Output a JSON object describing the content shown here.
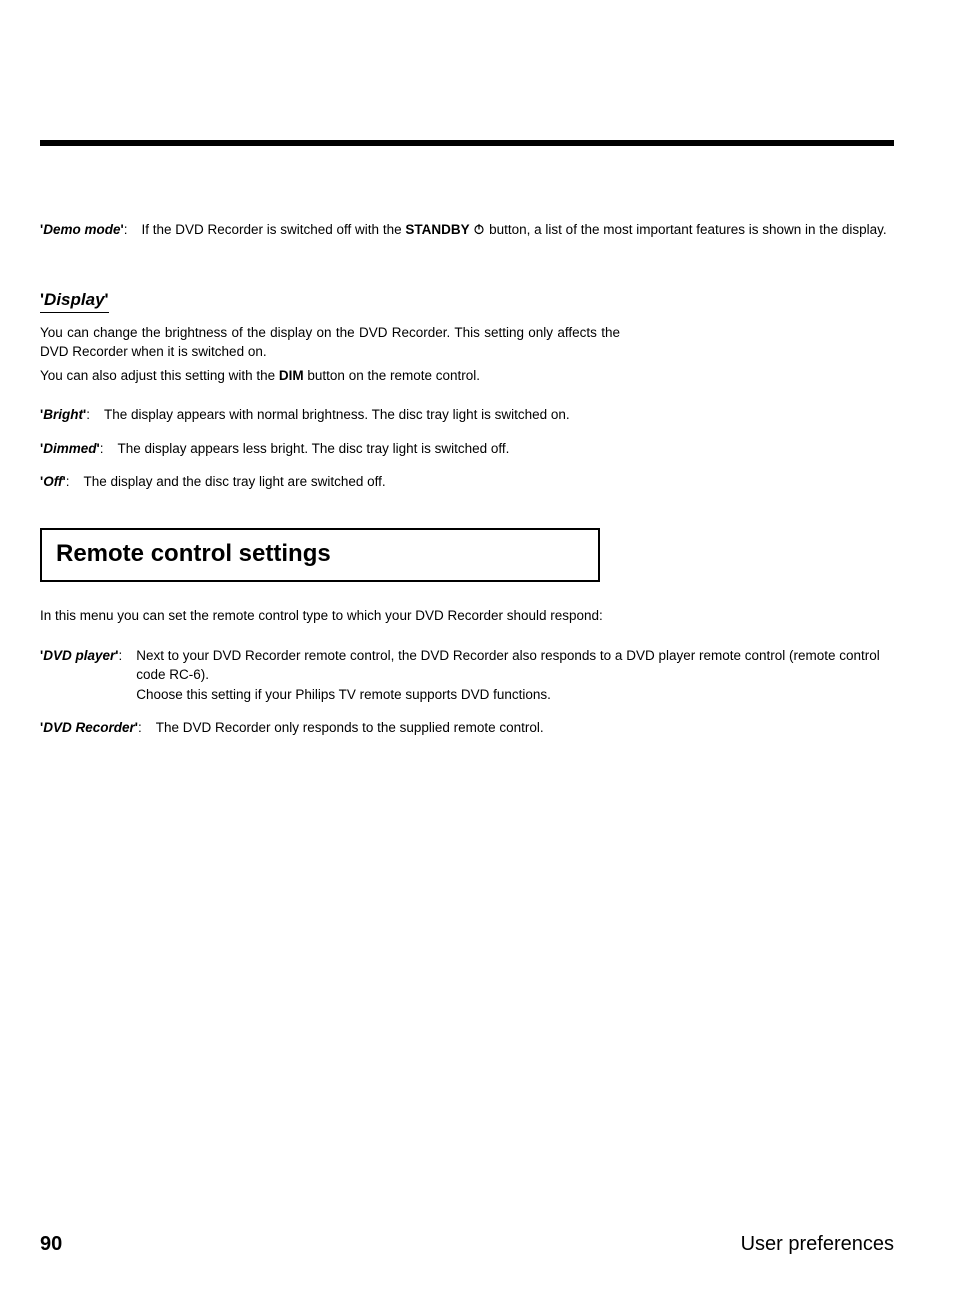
{
  "demo_mode": {
    "label": "Demo mode",
    "text_before": "If the DVD Recorder is switched off with the ",
    "button_label": "STANDBY",
    "text_after": " button, a list of the most important features is shown in the display."
  },
  "display_section": {
    "title": "Display",
    "para1": "You can change the brightness of the display on the DVD Recorder. This setting only affects the DVD Recorder when it is switched on.",
    "para2_before": "You can also adjust this setting with the ",
    "para2_bold": "DIM",
    "para2_after": " button on the remote control.",
    "items": [
      {
        "label": "Bright",
        "desc": "The display appears with normal brightness. The disc tray light is switched on."
      },
      {
        "label": "Dimmed",
        "desc": "The display appears less bright. The disc tray light is switched off."
      },
      {
        "label": "Off",
        "desc": "The display and the disc tray light are switched off."
      }
    ]
  },
  "remote_section": {
    "heading": "Remote control settings",
    "intro": "In this menu you can set the remote control type to which your DVD Recorder should respond:",
    "items": [
      {
        "label": "DVD player",
        "desc": "Next to your DVD Recorder remote control, the DVD Recorder also responds to a DVD player remote control (remote control code RC-6).\nChoose this setting if your Philips TV remote supports DVD functions."
      },
      {
        "label": "DVD Recorder",
        "desc": "The DVD Recorder only responds to the supplied remote control."
      }
    ]
  },
  "footer": {
    "page": "90",
    "section": "User preferences"
  }
}
